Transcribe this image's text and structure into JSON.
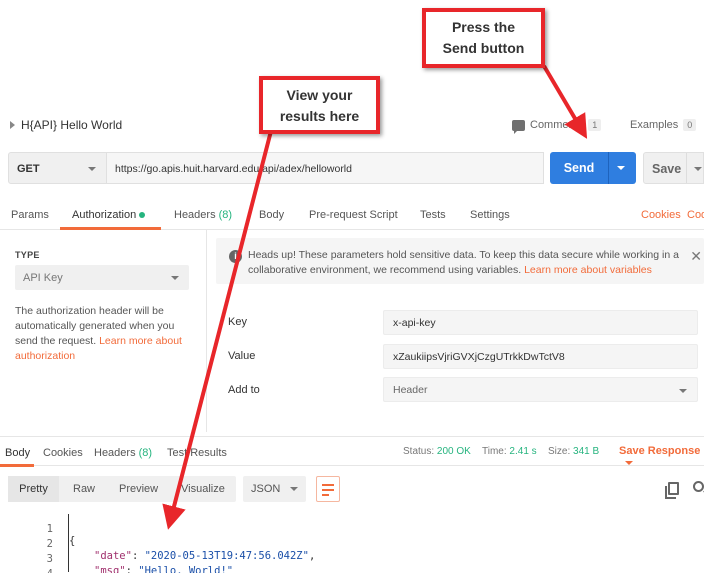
{
  "request": {
    "name": "H{API} Hello World",
    "comments_label": "Comments",
    "comments_count": "1",
    "examples_label": "Examples",
    "examples_count": "0"
  },
  "url_bar": {
    "method": "GET",
    "url": "https://go.apis.huit.harvard.edu/api/adex/helloworld",
    "send_label": "Send",
    "save_label": "Save"
  },
  "request_tabs": {
    "params": "Params",
    "authorization": "Authorization",
    "headers": "Headers",
    "headers_count": "(8)",
    "body": "Body",
    "prerequest": "Pre-request Script",
    "tests": "Tests",
    "settings": "Settings",
    "cookies": "Cookies",
    "code": "Cod"
  },
  "auth": {
    "type_label": "TYPE",
    "type_value": "API Key",
    "description": "The authorization header will be automatically generated when you send the request.",
    "learn_more": "Learn more about authorization"
  },
  "notice": {
    "text": "Heads up! These parameters hold sensitive data. To keep this data secure while working in a collaborative environment, we recommend using variables.",
    "link": "Learn more about variables"
  },
  "fields": {
    "key_label": "Key",
    "key_value": "x-api-key",
    "value_label": "Value",
    "value_value": "xZaukiipsVjriGVXjCzgUTrkkDwTctV8",
    "addto_label": "Add to",
    "addto_value": "Header"
  },
  "response": {
    "tabs": {
      "body": "Body",
      "cookies": "Cookies",
      "headers": "Headers",
      "headers_count": "(8)",
      "test_results": "Test Results"
    },
    "status_label": "Status:",
    "status_value": "200 OK",
    "time_label": "Time:",
    "time_value": "2.41 s",
    "size_label": "Size:",
    "size_value": "341 B",
    "save_response": "Save Response",
    "format": {
      "pretty": "Pretty",
      "raw": "Raw",
      "preview": "Preview",
      "visualize": "Visualize",
      "json": "JSON"
    },
    "code": {
      "l1": "{",
      "l2_key": "\"date\"",
      "l2_val": "\"2020-05-13T19:47:56.042Z\"",
      "l3_key": "\"msg\"",
      "l3_val": "\"Hello, World!\"",
      "l4": "}",
      "n1": "1",
      "n2": "2",
      "n3": "3",
      "n4": "4"
    }
  },
  "annotations": {
    "send_line1": "Press the",
    "send_line2": "Send button",
    "view_line1": "View your",
    "view_line2": "results here",
    "color": "#e8262a"
  },
  "colors": {
    "accent": "#f26b3a",
    "send": "#2f7ee0",
    "success": "#26b47f"
  }
}
